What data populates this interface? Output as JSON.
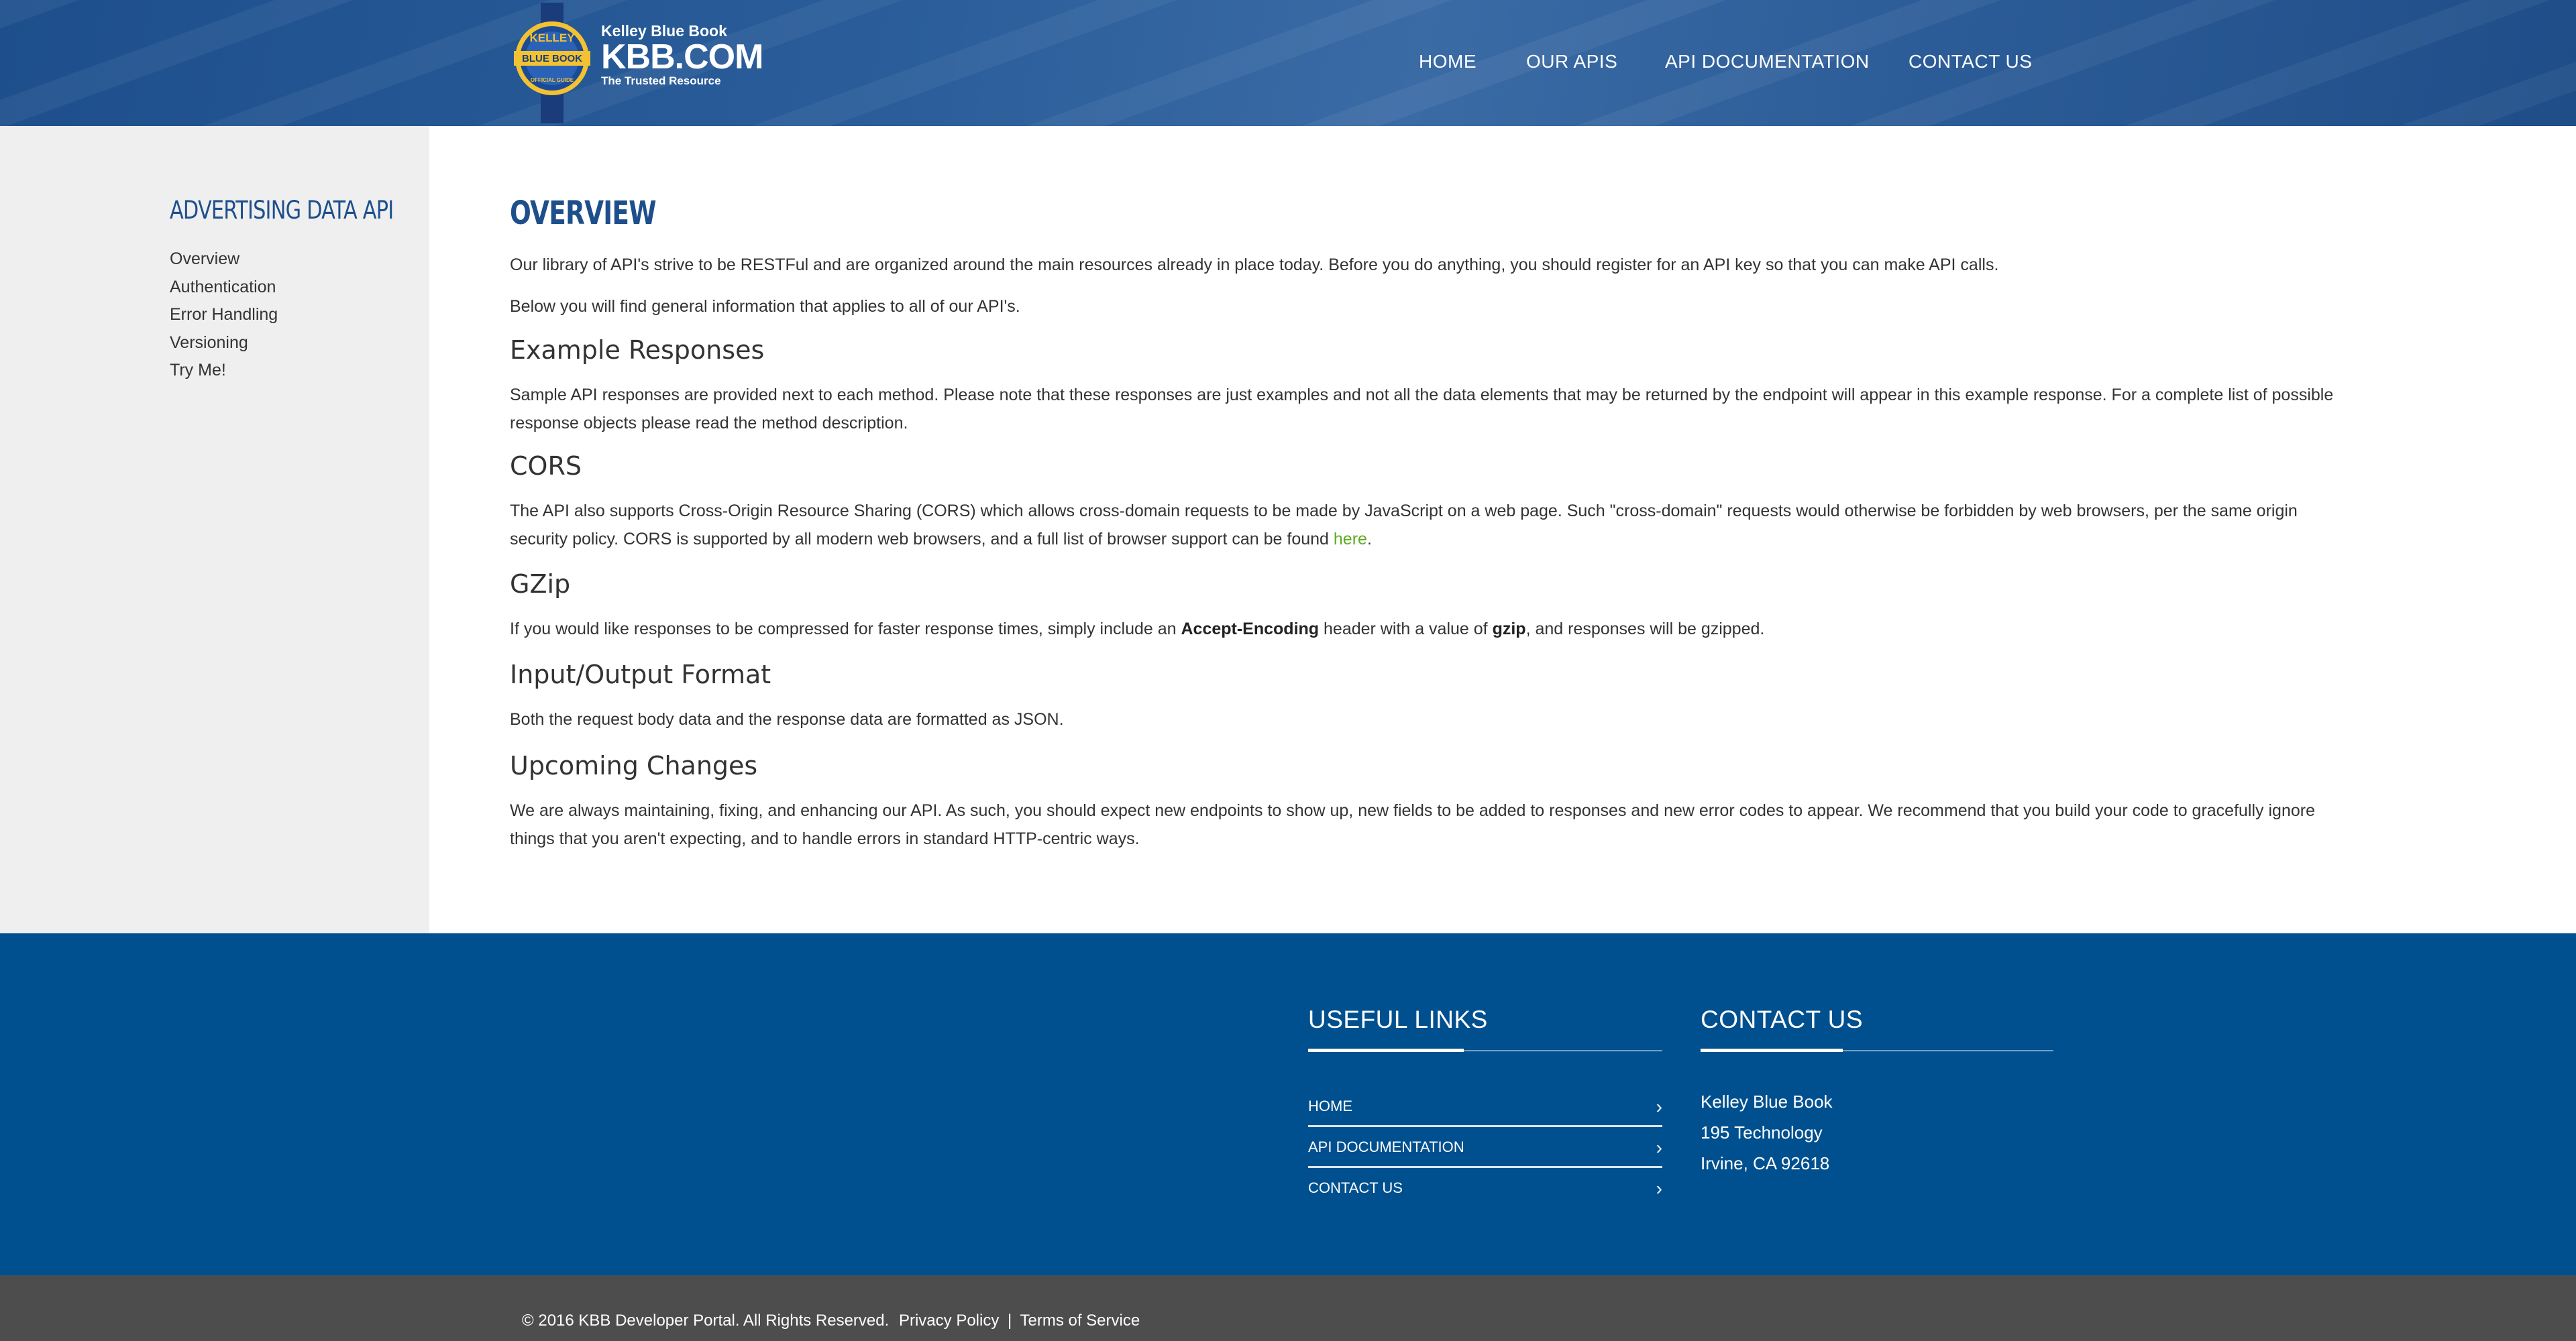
{
  "brand": {
    "seal_top": "KELLEY",
    "seal_middle": "BLUE BOOK",
    "seal_bottom": "OFFICIAL GUIDE",
    "small": "Kelley Blue Book",
    "big": "KBB.COM",
    "tagline": "The Trusted Resource"
  },
  "nav": {
    "items": [
      {
        "label": "HOME"
      },
      {
        "label": "OUR APIS"
      },
      {
        "label": "API DOCUMENTATION"
      },
      {
        "label": "CONTACT US"
      }
    ]
  },
  "sidebar": {
    "title": "ADVERTISING DATA API",
    "items": [
      {
        "label": "Overview"
      },
      {
        "label": "Authentication"
      },
      {
        "label": "Error Handling"
      },
      {
        "label": "Versioning"
      },
      {
        "label": "Try Me!"
      }
    ]
  },
  "main": {
    "title": "OVERVIEW",
    "intro1": "Our library of API's strive to be RESTFul and are organized around the main resources already in place today. Before you do anything, you should register for an API key so that you can make API calls.",
    "intro2": "Below you will find general information that applies to all of our API's.",
    "example_title": "Example Responses",
    "example_text_1": "Sample API responses are provided next to each method. Please note that these responses are just examples and not all the data elements that may be returned by the endpoint will appear in this example response. For a complete list of possible",
    "example_text_2": "response objects please read the method description.",
    "cors_title": "CORS",
    "cors_text_1": "The API also supports Cross-Origin Resource Sharing (CORS) which allows cross-domain requests to be made by JavaScript on a web page. Such \"cross-domain\" requests would otherwise be forbidden by web browsers, per the same origin",
    "cors_text_2": "security policy. CORS is supported by all modern web browsers, and a full list of browser support can be found ",
    "cors_link": "here",
    "cors_end": ".",
    "gzip_title": "GZip",
    "gzip_pre": "If you would like responses to be compressed for faster response times, simply include an ",
    "gzip_bold1": "Accept-Encoding",
    "gzip_mid": " header with a value of ",
    "gzip_bold2": "gzip",
    "gzip_post": ", and responses will be gzipped.",
    "io_title": "Input/Output Format",
    "io_text": "Both the request body data and the response data are formatted as JSON.",
    "upcoming_title": "Upcoming Changes",
    "upcoming_text_1": "We are always maintaining, fixing, and enhancing our API. As such, you should expect new endpoints to show up, new fields to be added to responses and new error codes to appear. We recommend that you build your code to gracefully ignore",
    "upcoming_text_2": "things that you aren't expecting, and to handle errors in standard HTTP-centric ways."
  },
  "footer": {
    "useful_title": "USEFUL LINKS",
    "useful_links": [
      {
        "label": "HOME"
      },
      {
        "label": "API DOCUMENTATION"
      },
      {
        "label": "CONTACT US"
      }
    ],
    "contact_title": "CONTACT US",
    "address": [
      "Kelley Blue Book",
      "195 Technology",
      "Irvine, CA 92618"
    ],
    "chevron": "›"
  },
  "bottom": {
    "copyright": "© 2016 KBB Developer Portal. All Rights Reserved.",
    "privacy": "Privacy Policy",
    "separator": "|",
    "terms": "Terms of Service"
  }
}
